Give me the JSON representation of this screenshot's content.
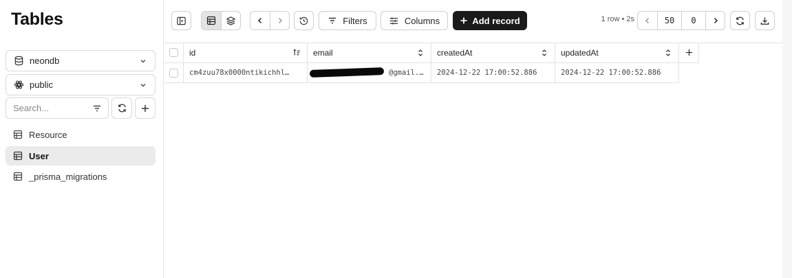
{
  "sidebar": {
    "title": "Tables",
    "database": "neondb",
    "schema": "public",
    "search_placeholder": "Search...",
    "items": [
      {
        "label": "Resource",
        "active": false
      },
      {
        "label": "User",
        "active": true
      },
      {
        "label": "_prisma_migrations",
        "active": false
      }
    ]
  },
  "toolbar": {
    "filters_label": "Filters",
    "columns_label": "Columns",
    "add_record_label": "Add record",
    "row_info": "1 row • 2s",
    "page_size": "50",
    "offset": "0"
  },
  "table": {
    "columns": [
      {
        "key": "id",
        "label": "id"
      },
      {
        "key": "email",
        "label": "email"
      },
      {
        "key": "createdAt",
        "label": "createdAt"
      },
      {
        "key": "updatedAt",
        "label": "updatedAt"
      }
    ],
    "rows": [
      {
        "id": "cm4zuu78x0000ntikichhl…",
        "email": "@gmail.…",
        "createdAt": "2024-12-22 17:00:52.886",
        "updatedAt": "2024-12-22 17:00:52.886"
      }
    ]
  },
  "colors": {
    "accent_dark": "#1a1a1a",
    "active_bg": "#ebebeb",
    "border": "#d9d9d9"
  }
}
